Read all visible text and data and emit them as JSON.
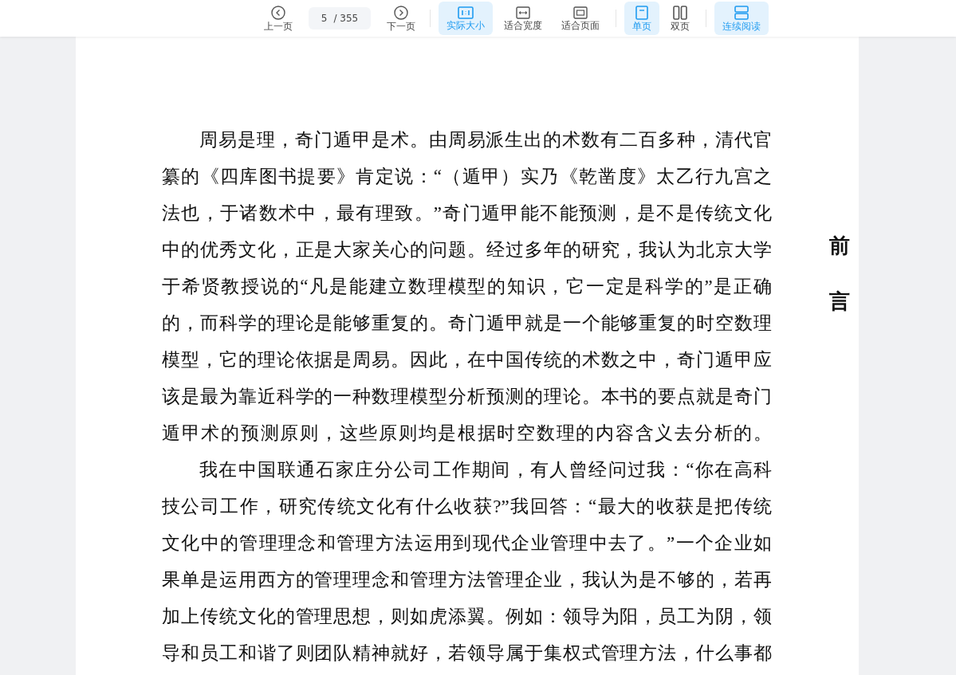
{
  "toolbar": {
    "previous": {
      "kind": "previous",
      "label": "上一页"
    },
    "page_field": {
      "value": "5",
      "total": "/ 355"
    },
    "next": {
      "kind": "next",
      "label": "下一页"
    },
    "groups": [
      [
        {
          "kind": "actual",
          "label": "实际大小",
          "selected": true
        },
        {
          "kind": "width",
          "label": "适合宽度",
          "selected": false
        },
        {
          "kind": "page",
          "label": "适合页面",
          "selected": false
        }
      ],
      [
        {
          "kind": "single",
          "label": "单页",
          "selected": true
        },
        {
          "kind": "double",
          "label": "双页",
          "selected": false
        }
      ],
      [
        {
          "kind": "continuous",
          "label": "连续阅读",
          "selected": true
        }
      ]
    ]
  },
  "page": {
    "side_heading": "前言",
    "paragraphs": [
      {
        "lines": [
          "周易是理，奇门遁甲是术。由周易派生出的术数有二百多种，清代官",
          "纂的《四库图书提要》肯定说：“（遁甲）实乃《乾凿度》太乙行九宫之",
          "法也，于诸数术中，最有理致。”奇门遁甲能不能预测，是不是传统文化",
          "中的优秀文化，正是大家关心的问题。经过多年的研究，我认为北京大学",
          "于希贤教授说的“凡是能建立数理模型的知识，它一定是科学的”是正确",
          "的，而科学的理论是能够重复的。奇门遁甲就是一个能够重复的时空数理",
          "模型，它的理论依据是周易。因此，在中国传统的术数之中，奇门遁甲应",
          "该是最为靠近科学的一种数理模型分析预测的理论。本书的要点就是奇门",
          "遁甲术的预测原则，这些原则均是根据时空数理的内容含义去分析的。"
        ]
      },
      {
        "lines": [
          "我在中国联通石家庄分公司工作期间，有人曾经问过我：“你在高科",
          "技公司工作，研究传统文化有什么收获?”我回答：“最大的收获是把传统",
          "文化中的管理理念和管理方法运用到现代企业管理中去了。”一个企业如",
          "果单是运用西方的管理理念和管理方法管理企业，我认为是不够的，若再",
          "加上传统文化的管理思想，则如虎添翼。例如：领导为阳，员工为阴，领",
          "导和员工和谐了则团队精神就好，若领导属于集权式管理方法，什么事都"
        ]
      }
    ]
  }
}
